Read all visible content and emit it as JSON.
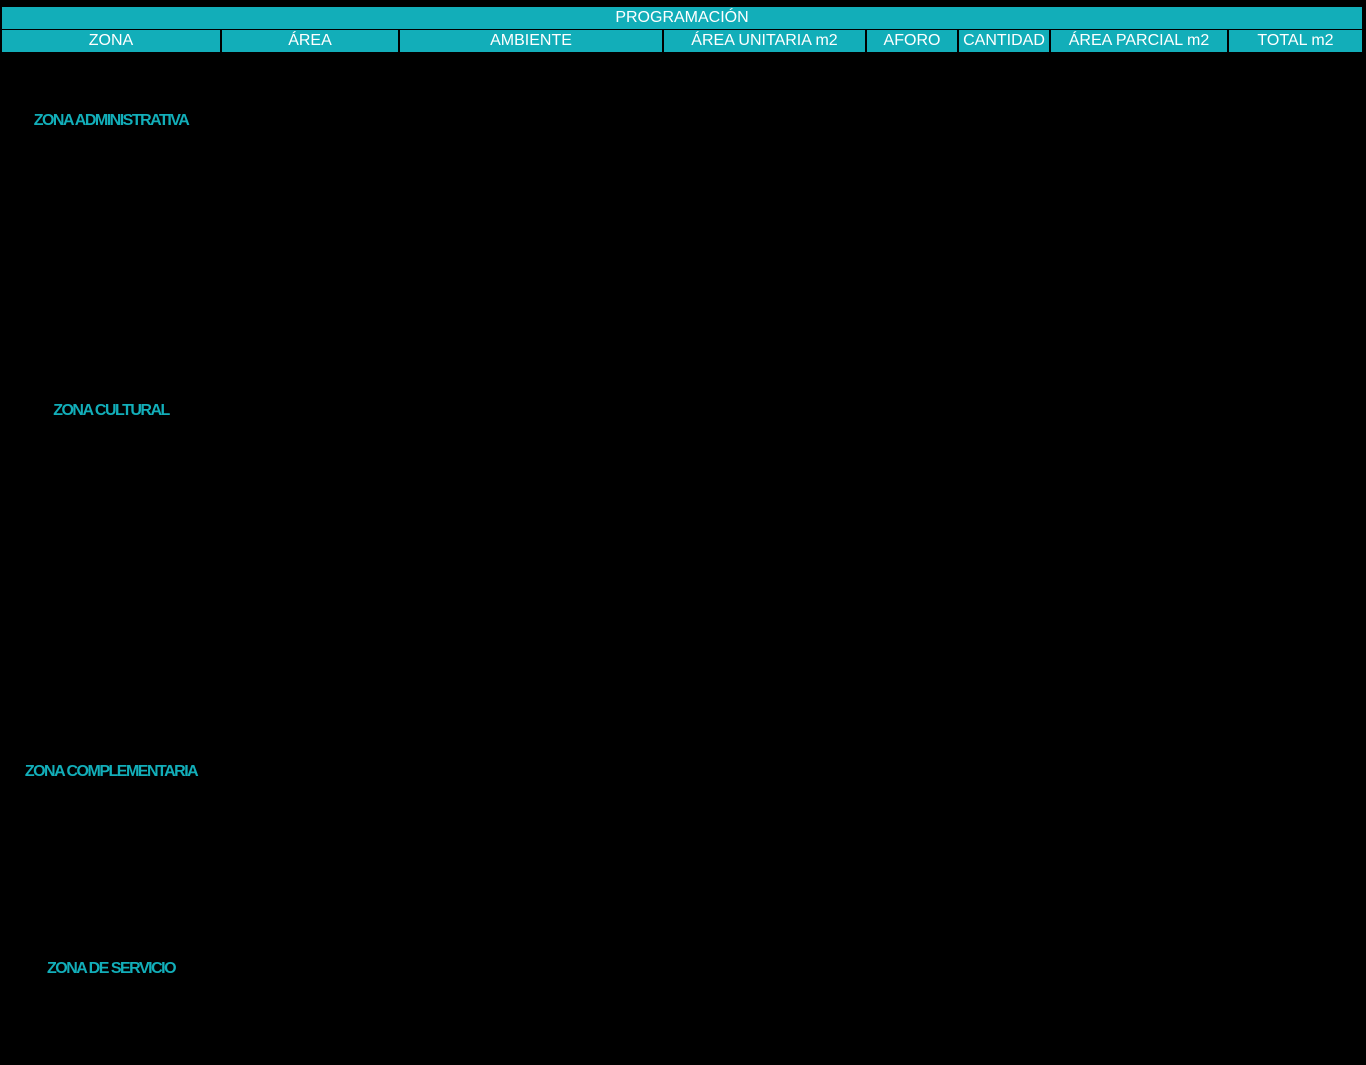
{
  "table": {
    "title": "PROGRAMACIÓN",
    "columns": [
      "ZONA",
      "ÁREA",
      "AMBIENTE",
      "ÁREA UNITARIA m2",
      "AFORO",
      "CANTIDAD",
      "ÁREA PARCIAL m2",
      "TOTAL m2"
    ],
    "zones": [
      "ZONA ADMINISTRATIVA",
      "ZONA CULTURAL",
      "ZONA COMPLEMENTARIA",
      "ZONA DE SERVICIO"
    ]
  },
  "colors": {
    "background": "#000000",
    "header_fill": "#12AEB9",
    "header_text": "#FFFFFF",
    "zone_text": "#12AEB9"
  }
}
